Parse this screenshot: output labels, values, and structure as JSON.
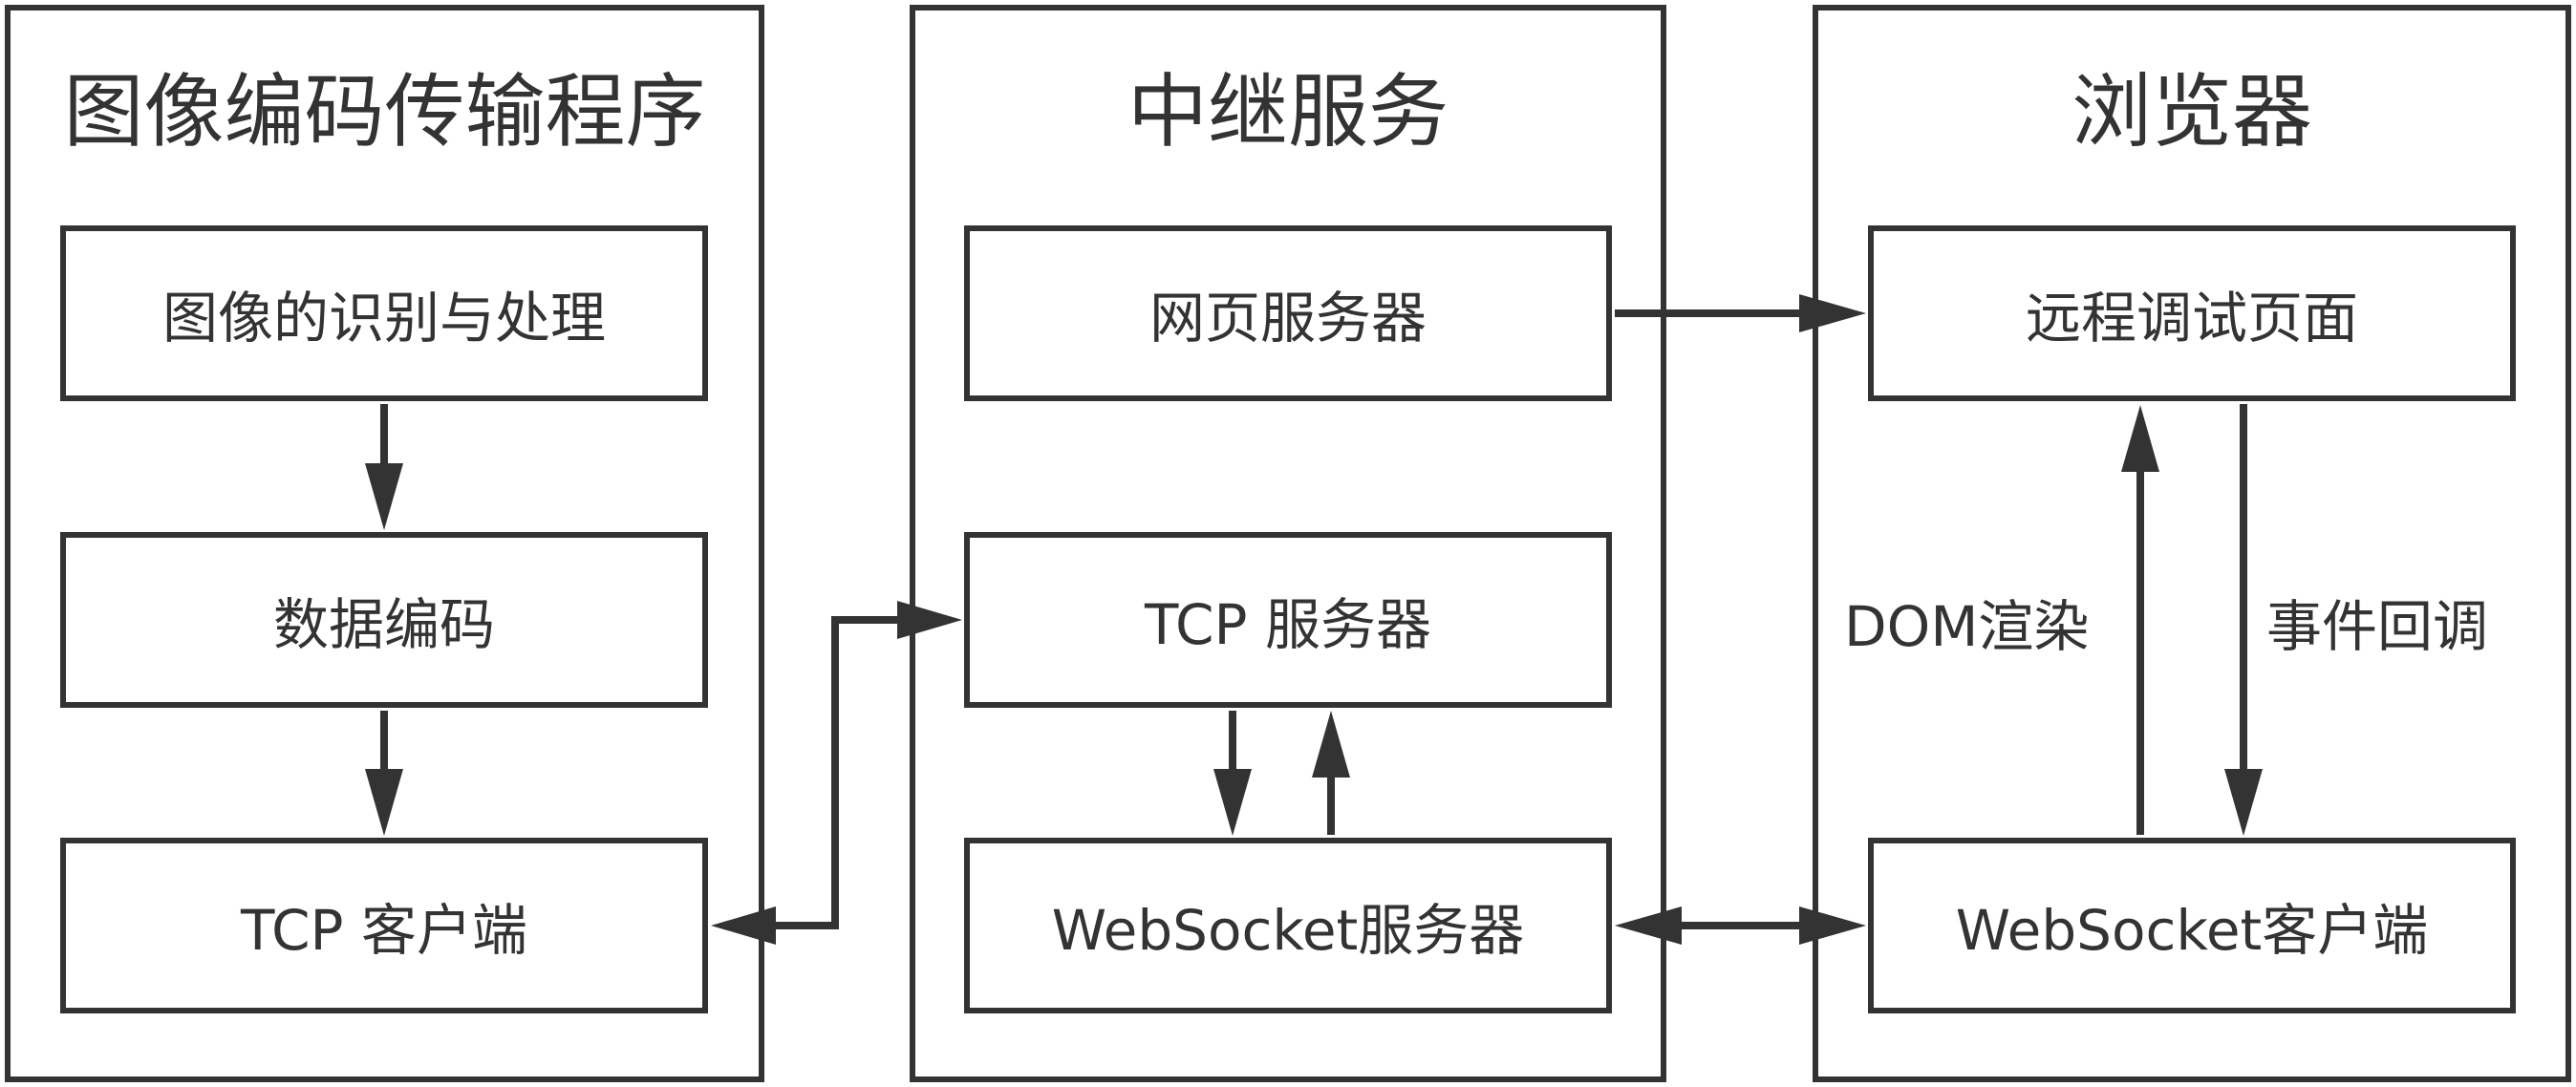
{
  "panels": {
    "encoder": {
      "title": "图像编码传输程序",
      "nodes": {
        "image_processing": "图像的识别与处理",
        "data_encoding": "数据编码",
        "tcp_client": "TCP 客户端"
      }
    },
    "relay": {
      "title": "中继服务",
      "nodes": {
        "web_server": "网页服务器",
        "tcp_server": "TCP 服务器",
        "websocket_server": "WebSocket服务器"
      }
    },
    "browser": {
      "title": "浏览器",
      "nodes": {
        "remote_debug_page": "远程调试页面",
        "websocket_client": "WebSocket客户端"
      }
    }
  },
  "edge_labels": {
    "dom_render": "DOM渲染",
    "event_callback": "事件回调"
  },
  "colors": {
    "stroke": "#333333",
    "background": "#ffffff"
  }
}
